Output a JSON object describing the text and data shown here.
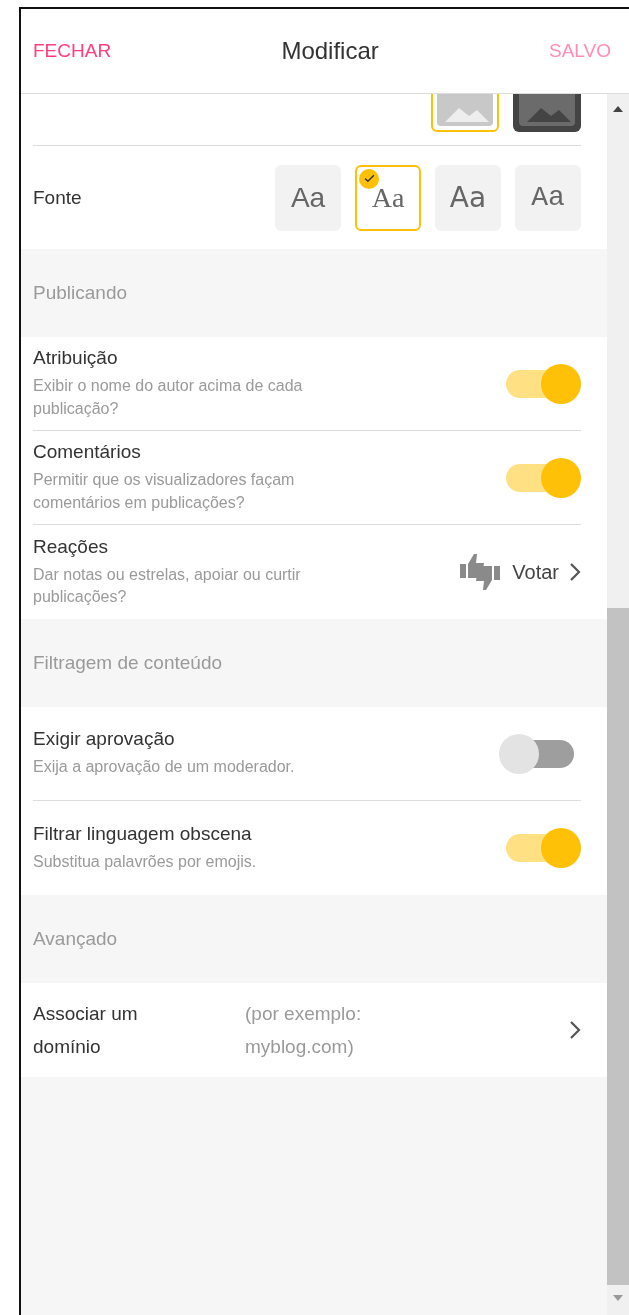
{
  "header": {
    "close": "FECHAR",
    "title": "Modificar",
    "save": {
      "label": "SALVO",
      "disabled": true
    }
  },
  "layout_options": [
    {
      "kind": "light",
      "selected": true
    },
    {
      "kind": "dark",
      "selected": false
    }
  ],
  "font": {
    "label": "Fonte",
    "options": [
      {
        "sample": "Aa",
        "kind": "sans",
        "selected": false
      },
      {
        "sample": "Aa",
        "kind": "serif",
        "selected": true
      },
      {
        "sample": "Aa",
        "kind": "thin",
        "selected": false
      },
      {
        "sample": "Aa",
        "kind": "mono",
        "selected": false
      }
    ]
  },
  "sections": [
    {
      "title": "Publicando",
      "rows": [
        {
          "kind": "toggle",
          "label": "Atribuição",
          "description": "Exibir o nome do autor acima de cada publicação?",
          "on": true
        },
        {
          "kind": "toggle",
          "label": "Comentários",
          "description": "Permitir que os visualizadores façam comentários em publicações?",
          "on": true
        },
        {
          "kind": "link",
          "label": "Reações",
          "description": "Dar notas ou estrelas, apoiar ou curtir publicações?",
          "value": "Votar"
        }
      ]
    },
    {
      "title": "Filtragem de conteúdo",
      "rows": [
        {
          "kind": "toggle",
          "label": "Exigir aprovação",
          "description": "Exija a aprovação de um moderador.",
          "on": false
        },
        {
          "kind": "toggle",
          "label": "Filtrar linguagem obscena",
          "description": "Substitua palavrões por emojis.",
          "on": true
        }
      ]
    },
    {
      "title": "Avançado",
      "rows": [
        {
          "kind": "field",
          "label": "Associar um domínio",
          "placeholder": "(por exemplo: myblog.com)"
        }
      ]
    }
  ]
}
